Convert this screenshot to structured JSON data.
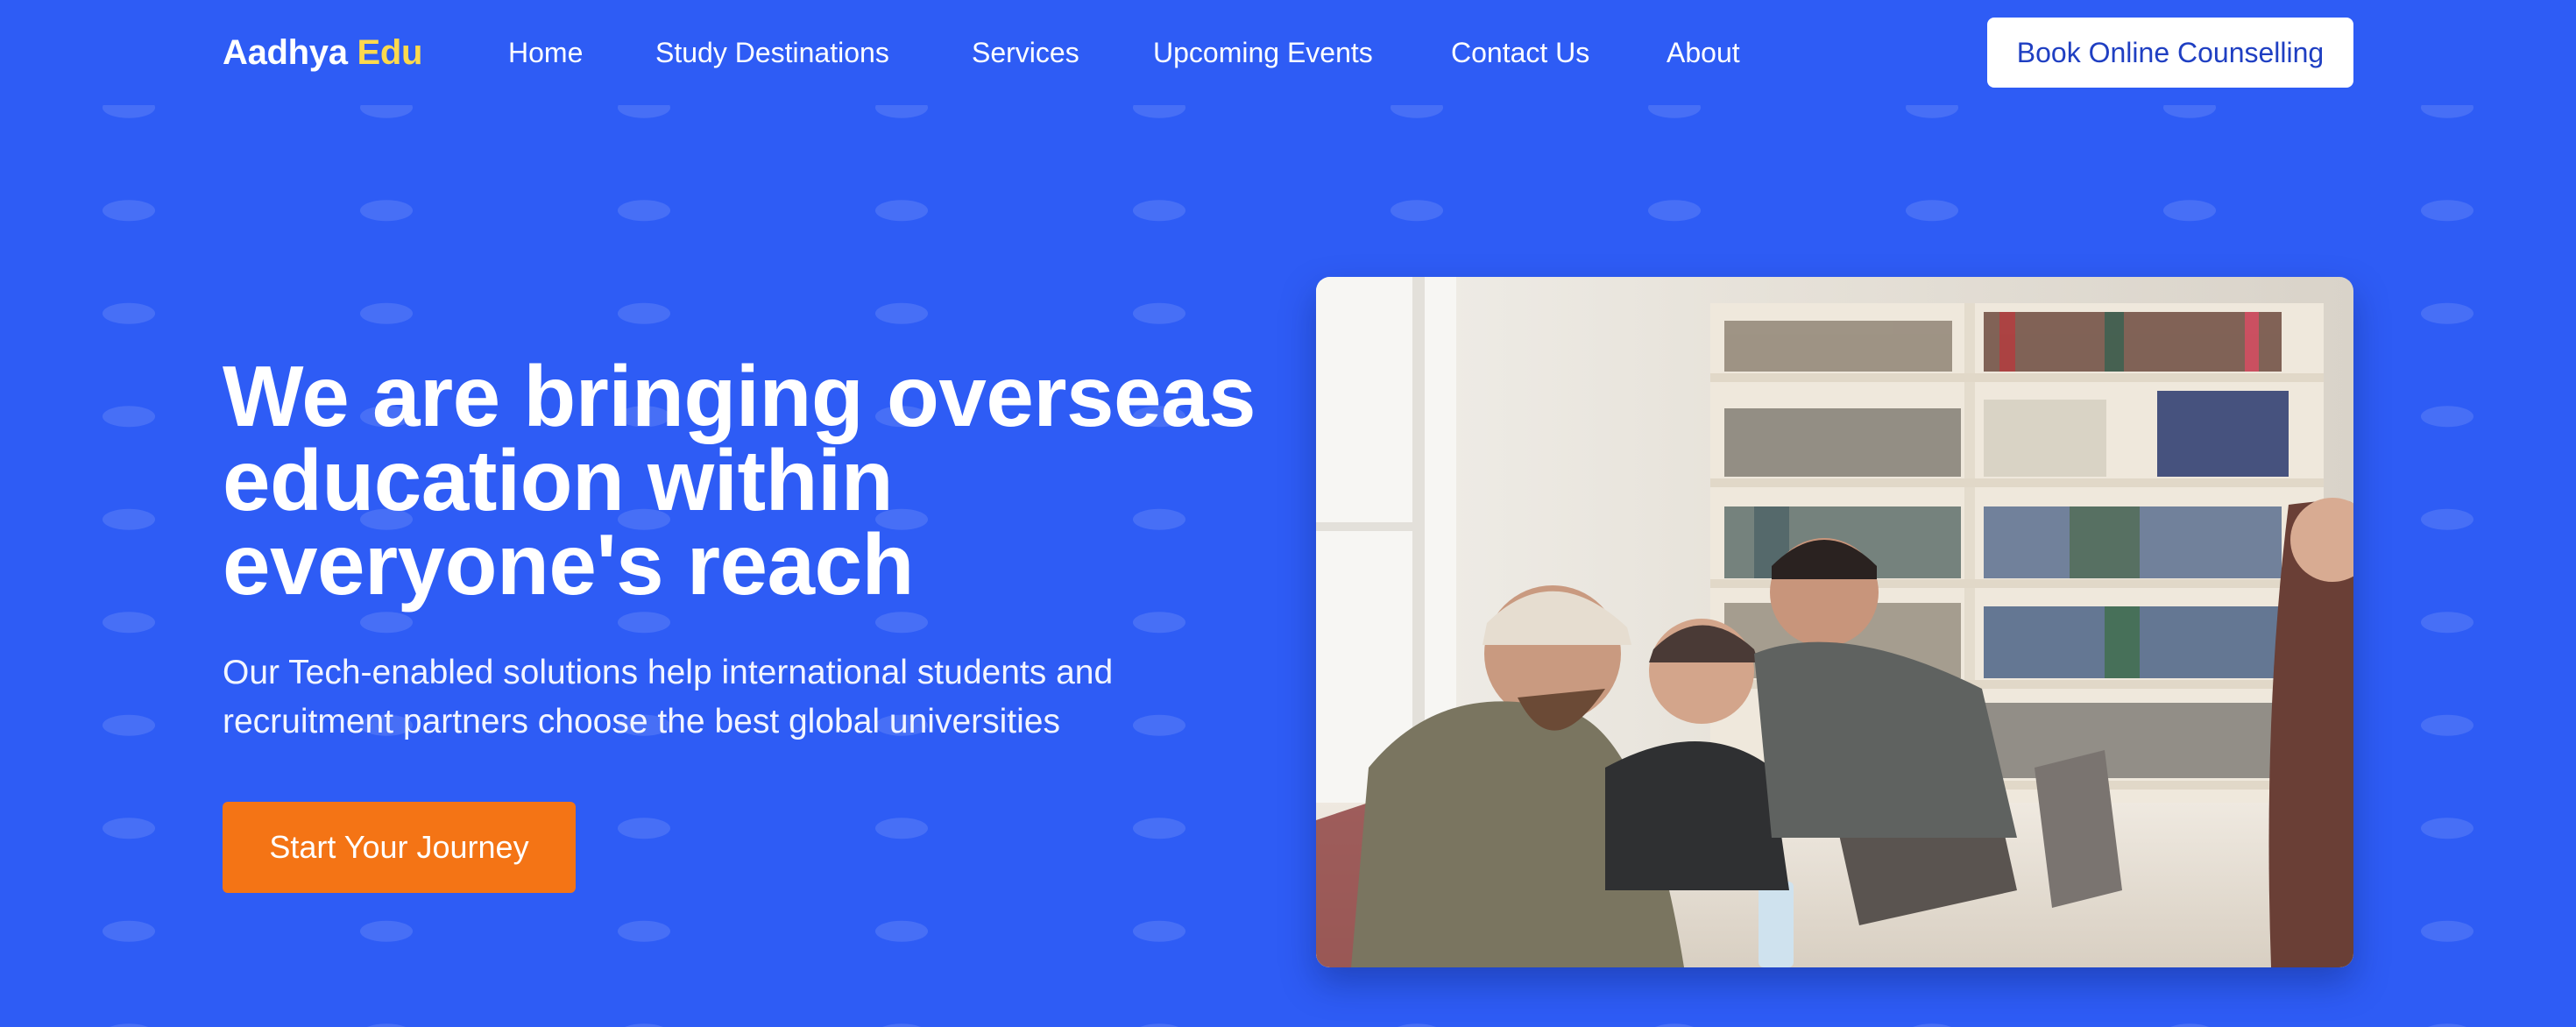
{
  "brand": {
    "name_main": "Aadhya",
    "name_accent": "Edu"
  },
  "nav": {
    "links": [
      "Home",
      "Study Destinations",
      "Services",
      "Upcoming Events",
      "Contact Us",
      "About"
    ],
    "cta_label": "Book Online Counselling"
  },
  "hero": {
    "title_lines": [
      "We are bringing overseas",
      "education within",
      "everyone's reach"
    ],
    "subtitle_lines": [
      "Our Tech-enabled solutions help international students and",
      "recruitment partners choose the best global universities"
    ],
    "cta_label": "Start Your Journey",
    "photo_alt": ""
  },
  "colors": {
    "background": "#2e5cf5",
    "accent_yellow": "#fcd94d",
    "cta_orange": "#f47415",
    "button_text_blue": "#1f3fc2"
  }
}
